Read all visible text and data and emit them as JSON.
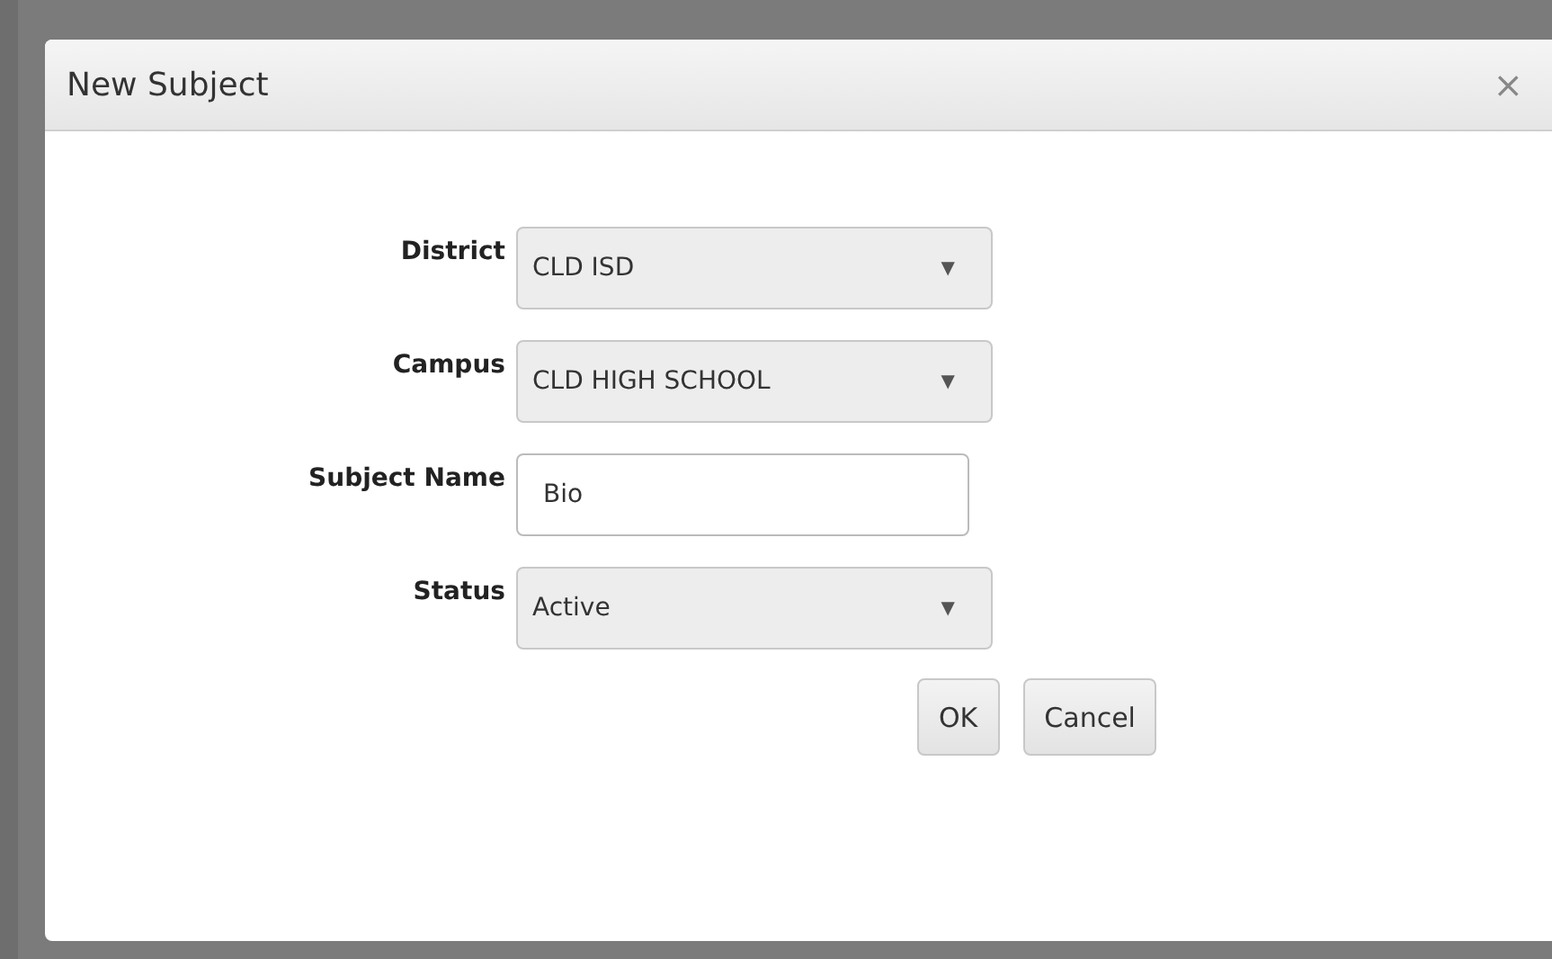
{
  "dialog": {
    "title": "New Subject",
    "close": "×"
  },
  "fields": [
    {
      "label": "District",
      "kind": "select",
      "value": "CLD ISD",
      "caret": "▼"
    },
    {
      "label": "Campus",
      "kind": "select",
      "value": "CLD HIGH SCHOOL",
      "caret": "▼"
    },
    {
      "label": "Subject Name",
      "kind": "text",
      "value": "Bio"
    },
    {
      "label": "Status",
      "kind": "select",
      "value": "Active",
      "caret": "▼"
    }
  ],
  "buttons": [
    "OK",
    "Cancel"
  ]
}
